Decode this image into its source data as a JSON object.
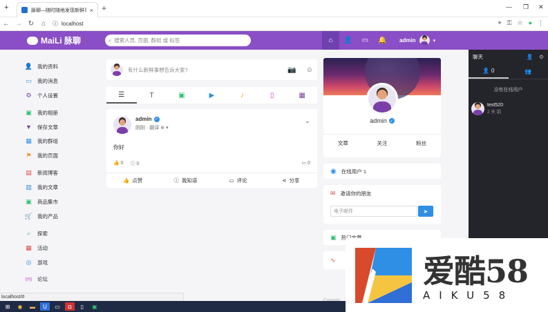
{
  "browser": {
    "tab_title": "脉聊—随时随地发现新鲜事",
    "url": "localhost",
    "status_url": "localhost/#"
  },
  "header": {
    "logo": "MaiLi 脉聊",
    "search_placeholder": "搜索人员, 页面, 群组 或 标签",
    "user_name": "admin"
  },
  "sidebar": {
    "items": [
      {
        "label": "我的资料",
        "icon": "user-icon",
        "color": "#2f8fe5"
      },
      {
        "label": "我的消息",
        "icon": "message-icon",
        "color": "#2f8fe5"
      },
      {
        "label": "个人设置",
        "icon": "gear-icon",
        "color": "#7b3fa8"
      },
      {
        "label": "我的相册",
        "icon": "image-icon",
        "color": "#2fbf71"
      },
      {
        "label": "保存文章",
        "icon": "bookmark-icon",
        "color": "#7b3fa8"
      },
      {
        "label": "我的群组",
        "icon": "grid-icon",
        "color": "#2f8fe5"
      },
      {
        "label": "我的页面",
        "icon": "flag-icon",
        "color": "#f0922f"
      },
      {
        "label": "新闻博客",
        "icon": "news-icon",
        "color": "#e04848"
      },
      {
        "label": "我的文章",
        "icon": "book-icon",
        "color": "#2f8fe5"
      },
      {
        "label": "商品集市",
        "icon": "bag-icon",
        "color": "#2fbf71"
      },
      {
        "label": "我的产品",
        "icon": "cart-icon",
        "color": "#2f8fe5"
      },
      {
        "label": "探索",
        "icon": "search-icon",
        "color": "#2fbf71"
      },
      {
        "label": "活动",
        "icon": "calendar-icon",
        "color": "#e04848"
      },
      {
        "label": "游戏",
        "icon": "game-icon",
        "color": "#2f8fe5"
      },
      {
        "label": "论坛",
        "icon": "broadcast-icon",
        "color": "#c23ab8"
      }
    ]
  },
  "composer": {
    "placeholder": "有什么新鲜事想告诉大家?"
  },
  "post": {
    "author": "admin",
    "meta": "刚刚 · 翻译",
    "text": "你好",
    "likes": "0",
    "wonders": "0",
    "comments": "0",
    "actions": [
      "点赞",
      "我知道",
      "评论",
      "分享"
    ]
  },
  "profile": {
    "name": "admin",
    "links": [
      "文章",
      "关注",
      "粉丝"
    ],
    "online_label": "在线用户 1",
    "invite_label": "邀请你的朋友",
    "invite_placeholder": "电子邮件",
    "extra_label": "热门文章"
  },
  "chat": {
    "title": "聊天",
    "online_count": "0",
    "none_text": "没有在线用户",
    "users": [
      {
        "name": "test520",
        "time": "2 天 前"
      }
    ]
  },
  "watermark": {
    "cn": "爱酷58",
    "en": "AIKU58"
  },
  "colors": {
    "header": "#8a4ec6",
    "accent": "#2f8fe5",
    "chat_bg": "#24242b"
  }
}
